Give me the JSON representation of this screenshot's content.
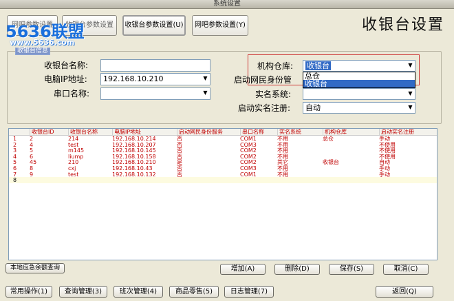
{
  "window": {
    "title": "系统设置"
  },
  "watermark": {
    "text": "5636联盟",
    "url": "www.5636.com"
  },
  "tabs": [
    {
      "label": "收银台参数设置",
      "shortcut": "(U)"
    },
    {
      "label": "网吧参数设置",
      "shortcut": "(Y)"
    }
  ],
  "tabs_hidden": {
    "t1": "网吧参数设置",
    "t2": "收银台参数设置"
  },
  "page_title": "收银台设置",
  "group": {
    "label": "收银台信息"
  },
  "form": {
    "cashier_name": {
      "label": "收银台名称:",
      "value": ""
    },
    "pc_ip": {
      "label": "电脑IP地址:",
      "value": "192.168.10.210"
    },
    "port_name": {
      "label": "串口名称:",
      "value": ""
    },
    "warehouse": {
      "label": "机构仓库:",
      "value": "收银台"
    },
    "id_service": {
      "label": "启动网民身份管",
      "value": ""
    },
    "realname_system": {
      "label": "实名系统:",
      "value": ""
    },
    "realname_register": {
      "label": "启动实名注册:",
      "value": "自动"
    }
  },
  "warehouse_options": [
    "总仓",
    "收银台"
  ],
  "warehouse_selected_index": 1,
  "table": {
    "headers": [
      "收银台ID",
      "收银台名称",
      "电脑IP地址",
      "启动网民身份服务",
      "串口名称",
      "实名系统",
      "机构仓库",
      "启动实名注册"
    ],
    "rows": [
      {
        "n": "1",
        "cells": [
          "2",
          "214",
          "192.168.10.214",
          "否",
          "COM1",
          "不用",
          "总仓",
          "手动"
        ]
      },
      {
        "n": "2",
        "cells": [
          "4",
          "test",
          "192.168.10.207",
          "否",
          "COM3",
          "不用",
          "",
          "不使用"
        ]
      },
      {
        "n": "3",
        "cells": [
          "5",
          "m145",
          "192.168.10.145",
          "否",
          "COM2",
          "不用",
          "",
          "不使用"
        ]
      },
      {
        "n": "4",
        "cells": [
          "6",
          "liump",
          "192.168.10.158",
          "否",
          "COM2",
          "不用",
          "",
          "不使用"
        ]
      },
      {
        "n": "5",
        "cells": [
          "45",
          "210",
          "192.168.10.210",
          "是",
          "COM2",
          "其它",
          "收银台",
          "自动"
        ]
      },
      {
        "n": "6",
        "cells": [
          "8",
          "cxj",
          "192.168.10.43",
          "否",
          "COM3",
          "不用",
          "",
          "手动"
        ]
      },
      {
        "n": "7",
        "cells": [
          "9",
          "test",
          "192.168.10.132",
          "否",
          "COM1",
          "不用",
          "",
          "手动"
        ]
      },
      {
        "n": "8",
        "cells": [
          "",
          "",
          "",
          "",
          "",
          "",
          "",
          ""
        ]
      }
    ]
  },
  "buttons": {
    "local_query": "本地应急余额查询",
    "add": "增加(A)",
    "delete": "删除(D)",
    "save": "保存(S)",
    "cancel": "取消(C)",
    "back": "返回(Q)"
  },
  "bottom_tabs": [
    "常用操作(1)",
    "查询管理(3)",
    "班次管理(4)",
    "商品零售(5)",
    "日志管理(7)"
  ]
}
